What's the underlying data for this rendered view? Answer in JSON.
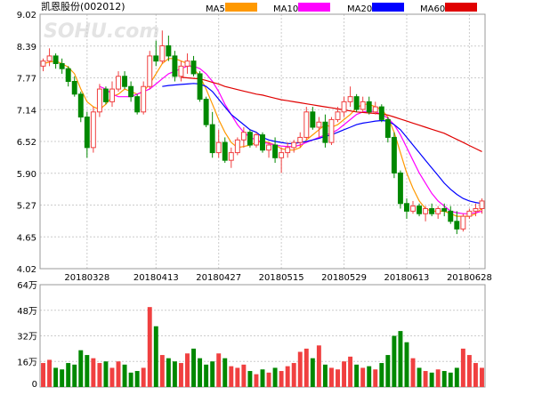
{
  "title": "凯恩股份(002012)",
  "watermark": "SOHU.com",
  "ma_legend": [
    {
      "label": "MA5",
      "color": "#ff9900"
    },
    {
      "label": "MA10",
      "color": "#ff00ff"
    },
    {
      "label": "MA20",
      "color": "#0000ff"
    },
    {
      "label": "MA60",
      "color": "#e00000"
    }
  ],
  "colors": {
    "up": "#f04040",
    "down": "#008800",
    "grid": "#cccccc",
    "frame": "#999999",
    "text": "#000000"
  },
  "chart_data": {
    "type": "candlestick",
    "price_axis": {
      "min": 4.02,
      "max": 9.02,
      "ticks": [
        "9.02",
        "8.39",
        "7.77",
        "7.14",
        "6.52",
        "5.90",
        "5.27",
        "4.65",
        "4.02"
      ]
    },
    "volume_axis": {
      "min": 0,
      "max": 64,
      "unit": "万",
      "ticks": [
        "64万",
        "48万",
        "32万",
        "16万",
        "0"
      ]
    },
    "date_labels": [
      "20180328",
      "20180413",
      "20180427",
      "20180515",
      "20180529",
      "20180613",
      "20180628"
    ],
    "date_label_index": [
      7,
      18,
      28,
      38,
      48,
      58,
      68
    ],
    "candles": [
      [
        8.0,
        8.15,
        7.9,
        8.1
      ],
      [
        8.1,
        8.35,
        8.0,
        8.2
      ],
      [
        8.2,
        8.25,
        7.95,
        8.05
      ],
      [
        8.05,
        8.15,
        7.85,
        7.95
      ],
      [
        7.95,
        8.0,
        7.6,
        7.7
      ],
      [
        7.7,
        7.8,
        7.4,
        7.45
      ],
      [
        7.45,
        7.5,
        6.9,
        7.0
      ],
      [
        7.0,
        7.1,
        6.2,
        6.4
      ],
      [
        6.4,
        7.2,
        6.3,
        7.1
      ],
      [
        7.1,
        7.65,
        7.0,
        7.55
      ],
      [
        7.55,
        7.6,
        7.25,
        7.3
      ],
      [
        7.3,
        7.7,
        7.2,
        7.55
      ],
      [
        7.55,
        7.9,
        7.5,
        7.8
      ],
      [
        7.8,
        7.9,
        7.55,
        7.6
      ],
      [
        7.6,
        7.7,
        7.3,
        7.4
      ],
      [
        7.4,
        7.45,
        7.05,
        7.1
      ],
      [
        7.1,
        7.7,
        7.05,
        7.6
      ],
      [
        7.6,
        8.3,
        7.55,
        8.2
      ],
      [
        8.2,
        8.5,
        8.0,
        8.1
      ],
      [
        8.1,
        8.7,
        8.05,
        8.4
      ],
      [
        8.4,
        8.6,
        8.1,
        8.2
      ],
      [
        8.2,
        8.3,
        7.7,
        7.8
      ],
      [
        7.8,
        8.1,
        7.7,
        8.0
      ],
      [
        8.0,
        8.25,
        7.85,
        8.1
      ],
      [
        8.1,
        8.2,
        7.8,
        7.85
      ],
      [
        7.85,
        7.9,
        7.3,
        7.35
      ],
      [
        7.35,
        7.4,
        6.8,
        6.85
      ],
      [
        6.85,
        7.1,
        6.2,
        6.3
      ],
      [
        6.3,
        6.75,
        6.2,
        6.5
      ],
      [
        6.5,
        6.6,
        6.1,
        6.15
      ],
      [
        6.15,
        6.4,
        6.0,
        6.3
      ],
      [
        6.3,
        6.6,
        6.25,
        6.55
      ],
      [
        6.55,
        6.8,
        6.4,
        6.7
      ],
      [
        6.7,
        6.75,
        6.4,
        6.45
      ],
      [
        6.45,
        6.7,
        6.4,
        6.65
      ],
      [
        6.65,
        6.7,
        6.3,
        6.35
      ],
      [
        6.35,
        6.5,
        6.2,
        6.45
      ],
      [
        6.45,
        6.6,
        6.1,
        6.2
      ],
      [
        6.2,
        6.4,
        5.9,
        6.3
      ],
      [
        6.3,
        6.5,
        6.2,
        6.4
      ],
      [
        6.4,
        6.55,
        6.3,
        6.5
      ],
      [
        6.5,
        6.7,
        6.4,
        6.6
      ],
      [
        6.6,
        7.2,
        6.55,
        7.1
      ],
      [
        7.1,
        7.2,
        6.75,
        6.8
      ],
      [
        6.8,
        7.0,
        6.6,
        6.9
      ],
      [
        6.9,
        7.05,
        6.4,
        6.5
      ],
      [
        6.5,
        7.0,
        6.45,
        6.95
      ],
      [
        6.95,
        7.2,
        6.9,
        7.1
      ],
      [
        7.1,
        7.4,
        7.0,
        7.3
      ],
      [
        7.3,
        7.6,
        7.2,
        7.4
      ],
      [
        7.4,
        7.45,
        7.1,
        7.15
      ],
      [
        7.15,
        7.4,
        7.1,
        7.3
      ],
      [
        7.3,
        7.4,
        7.05,
        7.1
      ],
      [
        7.1,
        7.3,
        7.05,
        7.2
      ],
      [
        7.2,
        7.25,
        6.9,
        6.95
      ],
      [
        6.95,
        7.0,
        6.5,
        6.6
      ],
      [
        6.6,
        6.7,
        5.8,
        5.9
      ],
      [
        5.9,
        5.95,
        5.2,
        5.3
      ],
      [
        5.3,
        5.4,
        5.0,
        5.15
      ],
      [
        5.15,
        5.35,
        5.1,
        5.25
      ],
      [
        5.25,
        5.3,
        5.05,
        5.1
      ],
      [
        5.1,
        5.25,
        4.95,
        5.2
      ],
      [
        5.2,
        5.3,
        5.05,
        5.1
      ],
      [
        5.1,
        5.25,
        5.0,
        5.2
      ],
      [
        5.2,
        5.3,
        5.05,
        5.15
      ],
      [
        5.15,
        5.25,
        4.9,
        4.95
      ],
      [
        4.95,
        5.15,
        4.7,
        4.8
      ],
      [
        4.8,
        5.1,
        4.75,
        5.05
      ],
      [
        5.05,
        5.2,
        5.0,
        5.15
      ],
      [
        5.15,
        5.3,
        5.05,
        5.2
      ],
      [
        5.2,
        5.4,
        5.1,
        5.35
      ]
    ],
    "volumes": [
      15,
      17,
      12,
      11,
      15,
      14,
      23,
      20,
      18,
      15,
      16,
      12,
      16,
      14,
      9,
      10,
      12,
      50,
      38,
      20,
      18,
      16,
      15,
      21,
      24,
      18,
      14,
      16,
      21,
      18,
      13,
      12,
      14,
      10,
      8,
      11,
      9,
      12,
      10,
      13,
      15,
      22,
      24,
      18,
      26,
      14,
      12,
      11,
      16,
      19,
      14,
      12,
      13,
      11,
      15,
      20,
      32,
      35,
      28,
      18,
      12,
      10,
      9,
      11,
      10,
      9,
      12,
      24,
      20,
      15,
      12
    ],
    "ma": {
      "MA5": [
        8.05,
        8.08,
        8.1,
        8.05,
        7.98,
        7.85,
        7.55,
        7.3,
        7.2,
        7.15,
        7.25,
        7.4,
        7.45,
        7.55,
        7.5,
        7.45,
        7.5,
        7.65,
        7.85,
        8.05,
        8.15,
        8.15,
        8.1,
        8.05,
        7.95,
        7.8,
        7.55,
        7.25,
        6.95,
        6.7,
        6.5,
        6.4,
        6.42,
        6.45,
        6.5,
        6.52,
        6.5,
        6.45,
        6.38,
        6.35,
        6.35,
        6.4,
        6.55,
        6.65,
        6.75,
        6.85,
        6.8,
        6.85,
        6.95,
        7.05,
        7.18,
        7.25,
        7.25,
        7.2,
        7.15,
        7.0,
        6.7,
        6.3,
        5.9,
        5.6,
        5.35,
        5.2,
        5.15,
        5.15,
        5.15,
        5.1,
        5.05,
        5.05,
        5.05,
        5.1,
        5.2
      ],
      "MA10": [
        null,
        null,
        null,
        null,
        null,
        null,
        null,
        null,
        null,
        7.6,
        7.55,
        7.45,
        7.4,
        7.4,
        7.4,
        7.45,
        7.5,
        7.55,
        7.65,
        7.75,
        7.85,
        7.9,
        7.95,
        8.0,
        8.0,
        7.95,
        7.85,
        7.7,
        7.5,
        7.25,
        7.05,
        6.85,
        6.7,
        6.6,
        6.55,
        6.5,
        6.48,
        6.45,
        6.43,
        6.42,
        6.42,
        6.45,
        6.5,
        6.55,
        6.6,
        6.65,
        6.68,
        6.75,
        6.85,
        6.95,
        7.05,
        7.1,
        7.12,
        7.1,
        7.05,
        6.98,
        6.85,
        6.65,
        6.4,
        6.15,
        5.9,
        5.7,
        5.5,
        5.35,
        5.25,
        5.15,
        5.12,
        5.1,
        5.1,
        5.12,
        5.15
      ],
      "MA20": [
        null,
        null,
        null,
        null,
        null,
        null,
        null,
        null,
        null,
        null,
        null,
        null,
        null,
        null,
        null,
        null,
        null,
        null,
        null,
        7.6,
        7.62,
        7.63,
        7.64,
        7.65,
        7.66,
        7.65,
        7.6,
        7.5,
        7.35,
        7.2,
        7.05,
        6.95,
        6.85,
        6.75,
        6.7,
        6.6,
        6.55,
        6.52,
        6.5,
        6.48,
        6.48,
        6.5,
        6.52,
        6.55,
        6.58,
        6.62,
        6.65,
        6.7,
        6.75,
        6.8,
        6.85,
        6.88,
        6.9,
        6.92,
        6.93,
        6.92,
        6.85,
        6.75,
        6.6,
        6.45,
        6.3,
        6.15,
        6.0,
        5.85,
        5.7,
        5.58,
        5.48,
        5.4,
        5.35,
        5.32,
        5.3
      ],
      "MA60": [
        null,
        null,
        null,
        null,
        null,
        null,
        null,
        null,
        null,
        null,
        null,
        null,
        null,
        null,
        null,
        null,
        null,
        null,
        null,
        null,
        null,
        null,
        7.78,
        7.77,
        7.76,
        7.75,
        7.72,
        7.68,
        7.65,
        7.6,
        7.57,
        7.54,
        7.51,
        7.48,
        7.45,
        7.43,
        7.4,
        7.37,
        7.34,
        7.32,
        7.3,
        7.28,
        7.26,
        7.24,
        7.22,
        7.2,
        7.18,
        7.16,
        7.14,
        7.12,
        7.1,
        7.09,
        7.08,
        7.07,
        7.06,
        7.04,
        7.0,
        6.96,
        6.92,
        6.88,
        6.84,
        6.8,
        6.76,
        6.72,
        6.68,
        6.62,
        6.56,
        6.5,
        6.44,
        6.38,
        6.32
      ]
    }
  }
}
